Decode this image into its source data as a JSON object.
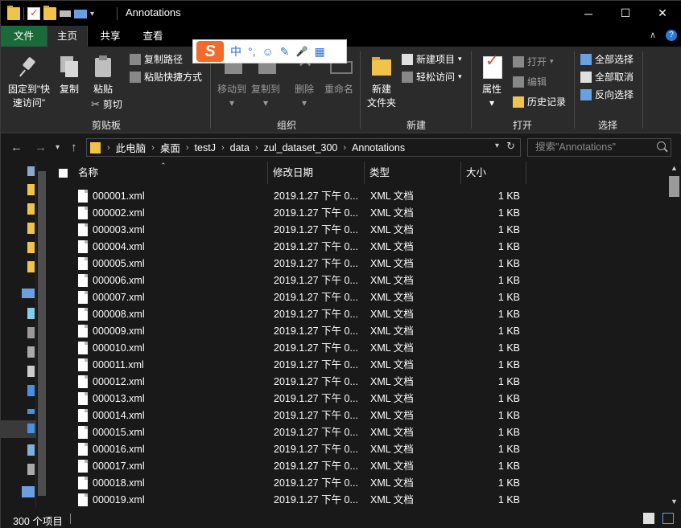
{
  "window": {
    "title": "Annotations"
  },
  "tabs": {
    "file": "文件",
    "home": "主页",
    "share": "共享",
    "view": "查看"
  },
  "ime": {
    "logo": "S",
    "mode": "中",
    "punct": "°,",
    "emoji": "☺",
    "skin": "✎",
    "mic": "🎤",
    "grid": "▦"
  },
  "ribbon": {
    "clipboard": {
      "label": "剪贴板",
      "pin_line1": "固定到\"快",
      "pin_line2": "速访问\"",
      "copy": "复制",
      "paste": "粘贴",
      "copy_path": "复制路径",
      "paste_shortcut": "粘贴快捷方式",
      "cut": "剪切"
    },
    "organize": {
      "label": "组织",
      "move_to": "移动到",
      "copy_to": "复制到",
      "delete": "删除",
      "rename": "重命名"
    },
    "new": {
      "label": "新建",
      "new_folder_line1": "新建",
      "new_folder_line2": "文件夹",
      "new_item": "新建项目",
      "easy_access": "轻松访问"
    },
    "open": {
      "label": "打开",
      "properties": "属性",
      "open": "打开",
      "edit": "编辑",
      "history": "历史记录"
    },
    "select": {
      "label": "选择",
      "select_all": "全部选择",
      "select_none": "全部取消",
      "invert": "反向选择"
    }
  },
  "address": {
    "crumbs": [
      "此电脑",
      "桌面",
      "testJ",
      "data",
      "zul_dataset_300",
      "Annotations"
    ],
    "search_placeholder": "搜索\"Annotations\""
  },
  "columns": {
    "name": "名称",
    "modified": "修改日期",
    "type": "类型",
    "size": "大小"
  },
  "files": [
    {
      "name": "000001.xml",
      "modified": "2019.1.27 下午 0...",
      "type": "XML 文档",
      "size": "1 KB"
    },
    {
      "name": "000002.xml",
      "modified": "2019.1.27 下午 0...",
      "type": "XML 文档",
      "size": "1 KB"
    },
    {
      "name": "000003.xml",
      "modified": "2019.1.27 下午 0...",
      "type": "XML 文档",
      "size": "1 KB"
    },
    {
      "name": "000004.xml",
      "modified": "2019.1.27 下午 0...",
      "type": "XML 文档",
      "size": "1 KB"
    },
    {
      "name": "000005.xml",
      "modified": "2019.1.27 下午 0...",
      "type": "XML 文档",
      "size": "1 KB"
    },
    {
      "name": "000006.xml",
      "modified": "2019.1.27 下午 0...",
      "type": "XML 文档",
      "size": "1 KB"
    },
    {
      "name": "000007.xml",
      "modified": "2019.1.27 下午 0...",
      "type": "XML 文档",
      "size": "1 KB"
    },
    {
      "name": "000008.xml",
      "modified": "2019.1.27 下午 0...",
      "type": "XML 文档",
      "size": "1 KB"
    },
    {
      "name": "000009.xml",
      "modified": "2019.1.27 下午 0...",
      "type": "XML 文档",
      "size": "1 KB"
    },
    {
      "name": "000010.xml",
      "modified": "2019.1.27 下午 0...",
      "type": "XML 文档",
      "size": "1 KB"
    },
    {
      "name": "000011.xml",
      "modified": "2019.1.27 下午 0...",
      "type": "XML 文档",
      "size": "1 KB"
    },
    {
      "name": "000012.xml",
      "modified": "2019.1.27 下午 0...",
      "type": "XML 文档",
      "size": "1 KB"
    },
    {
      "name": "000013.xml",
      "modified": "2019.1.27 下午 0...",
      "type": "XML 文档",
      "size": "1 KB"
    },
    {
      "name": "000014.xml",
      "modified": "2019.1.27 下午 0...",
      "type": "XML 文档",
      "size": "1 KB"
    },
    {
      "name": "000015.xml",
      "modified": "2019.1.27 下午 0...",
      "type": "XML 文档",
      "size": "1 KB"
    },
    {
      "name": "000016.xml",
      "modified": "2019.1.27 下午 0...",
      "type": "XML 文档",
      "size": "1 KB"
    },
    {
      "name": "000017.xml",
      "modified": "2019.1.27 下午 0...",
      "type": "XML 文档",
      "size": "1 KB"
    },
    {
      "name": "000018.xml",
      "modified": "2019.1.27 下午 0...",
      "type": "XML 文档",
      "size": "1 KB"
    },
    {
      "name": "000019.xml",
      "modified": "2019.1.27 下午 0...",
      "type": "XML 文档",
      "size": "1 KB"
    }
  ],
  "status": {
    "item_count": "300 个项目"
  }
}
